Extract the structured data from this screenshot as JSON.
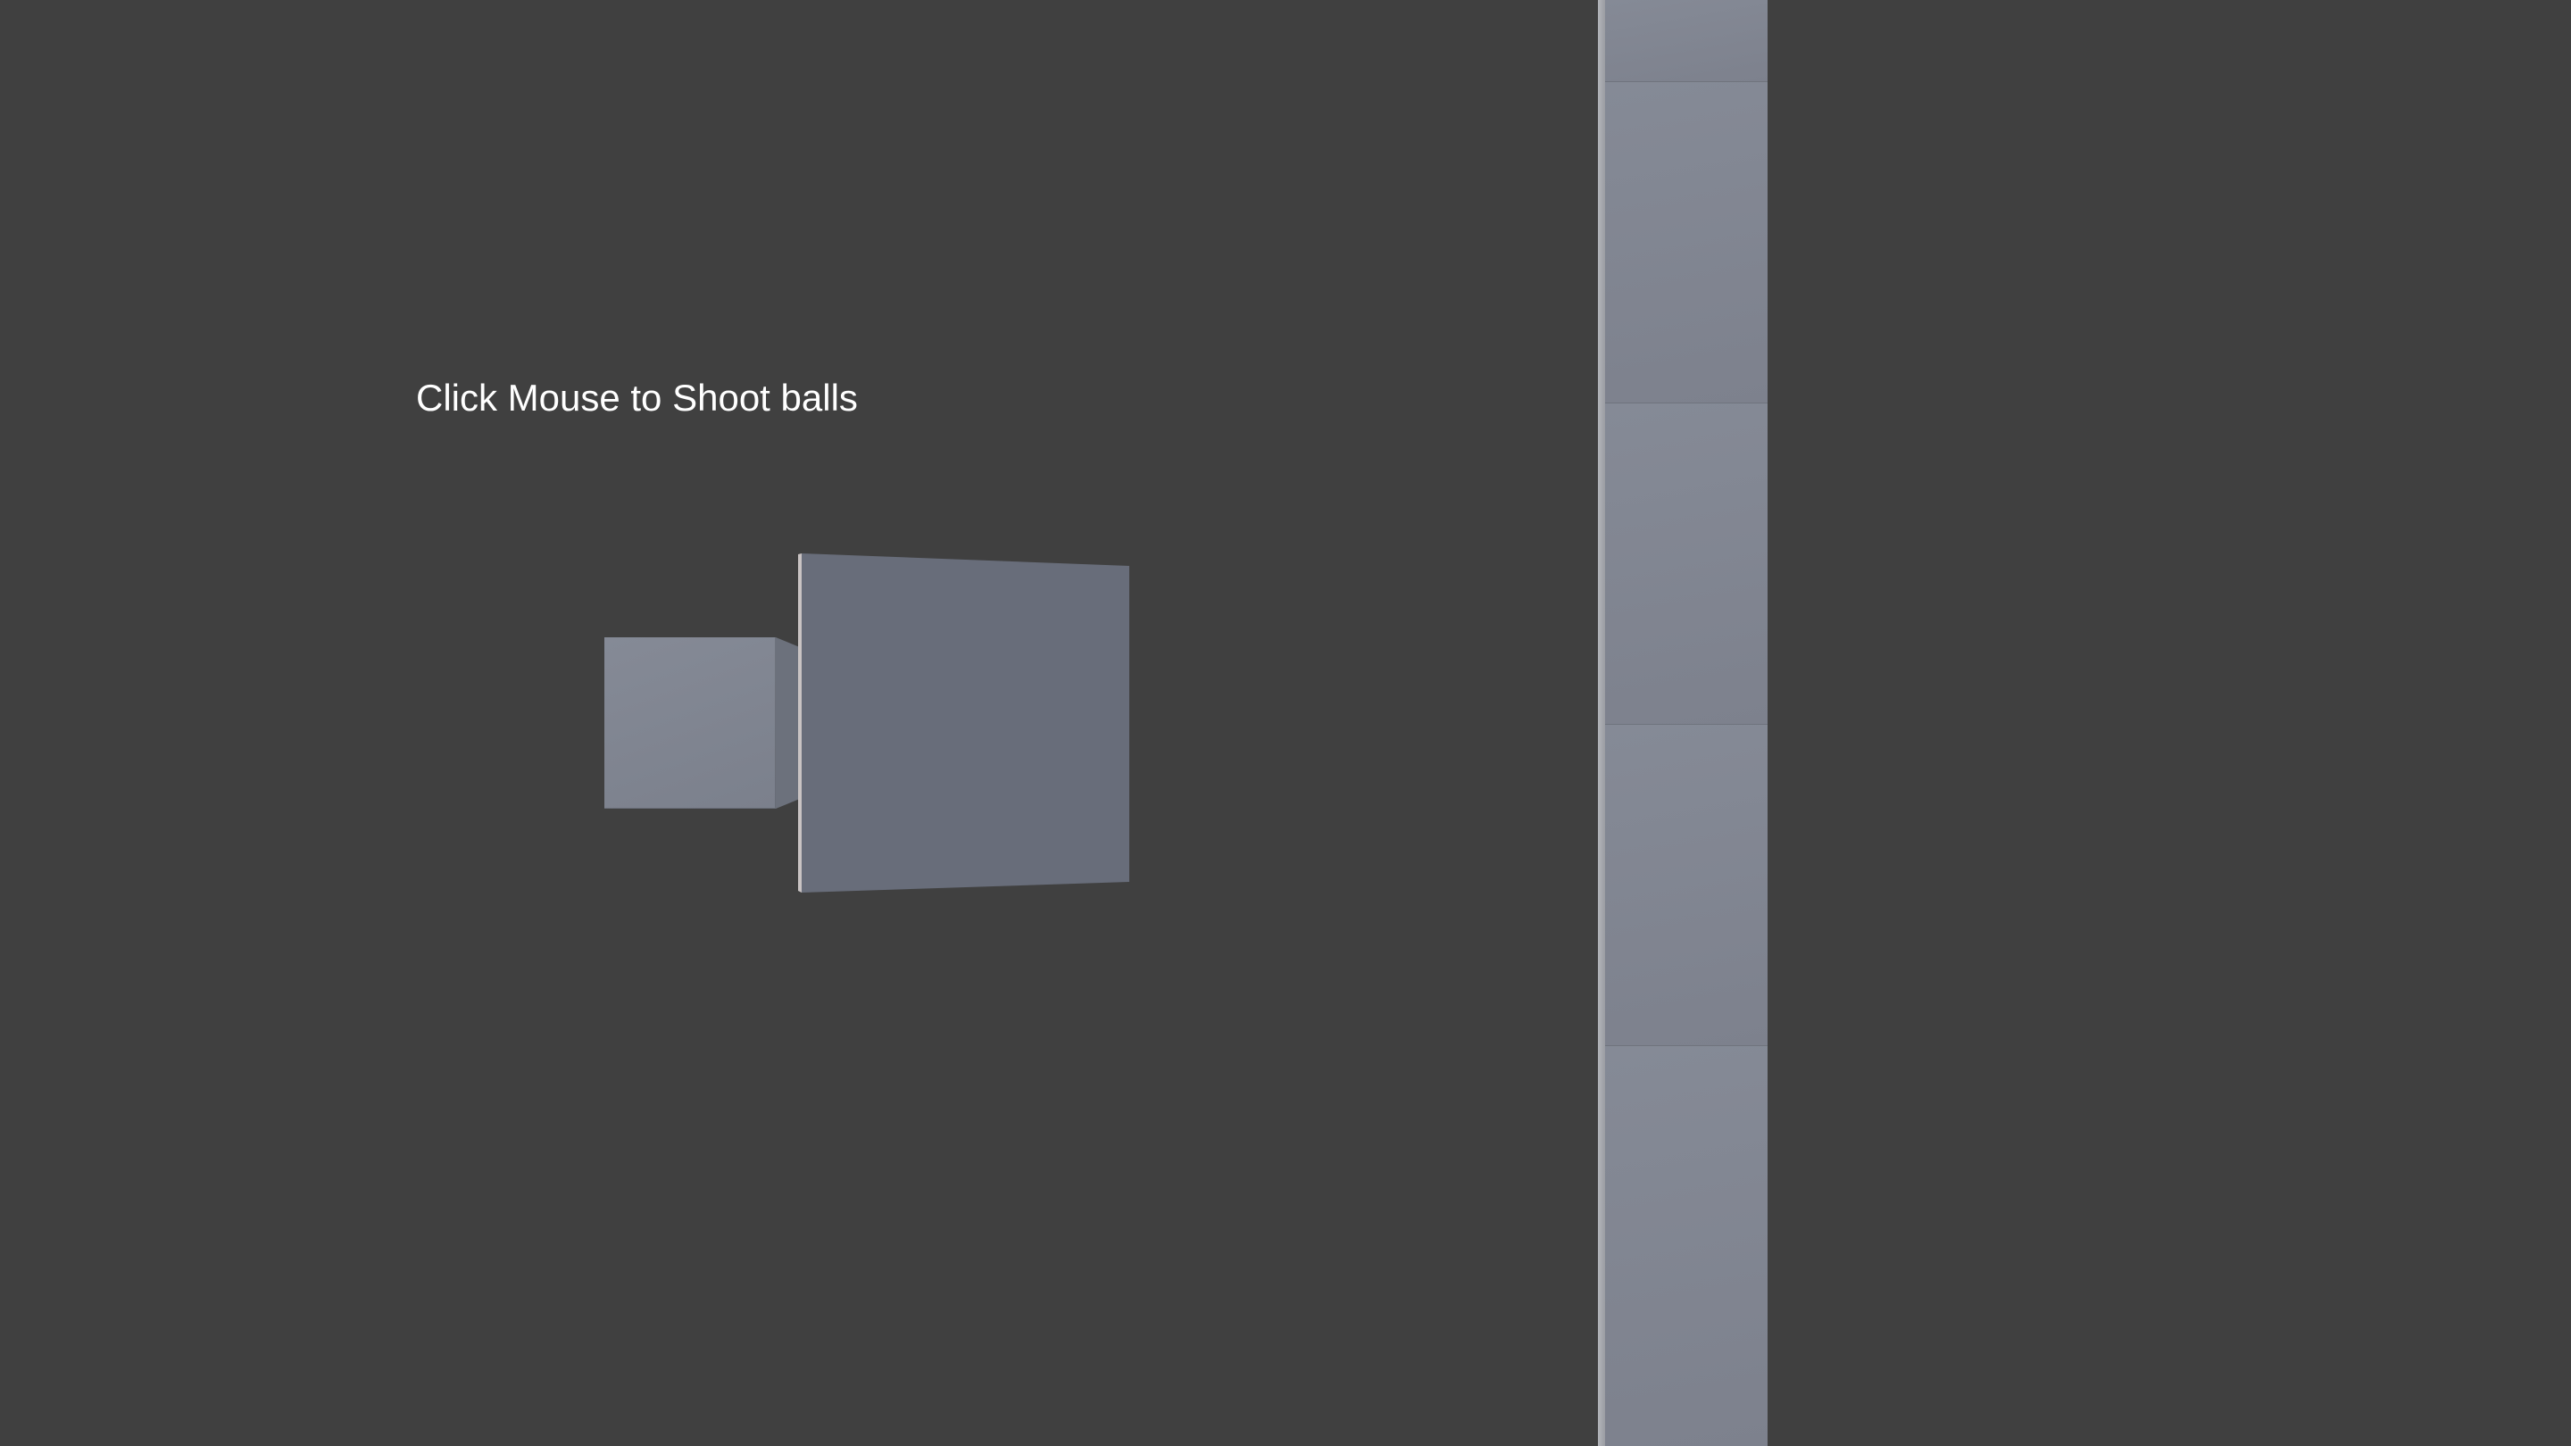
{
  "hud": {
    "instruction": "Click Mouse to Shoot balls"
  },
  "colors": {
    "background": "#404040",
    "cube": "#858a96",
    "target_face": "#686d7a",
    "wall": "#7f8490",
    "text": "#ffffff"
  }
}
